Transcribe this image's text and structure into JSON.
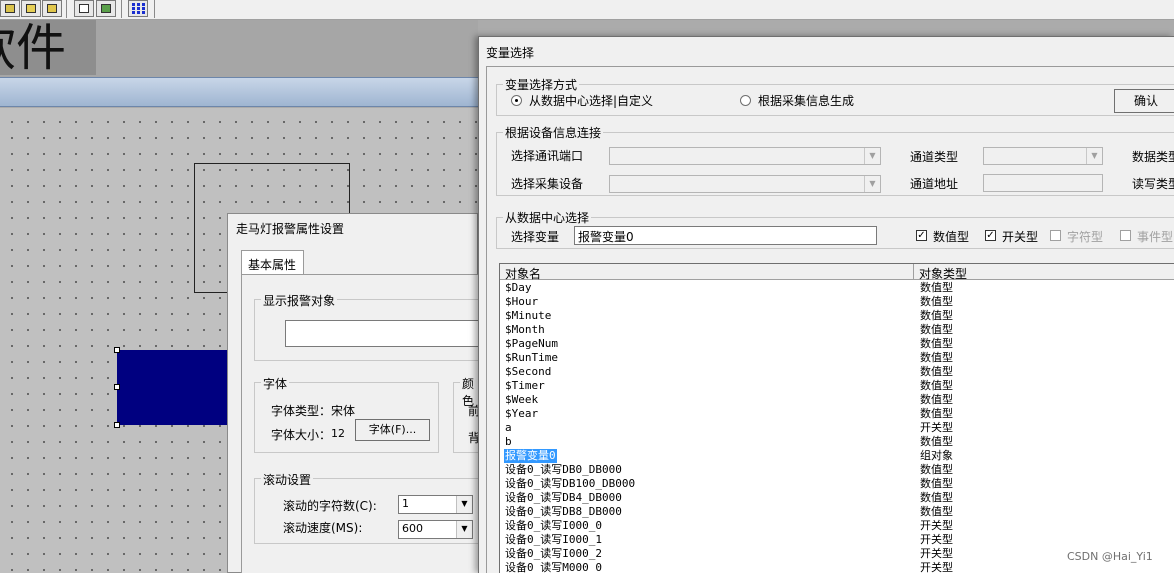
{
  "background": {
    "title_fragment": "软件"
  },
  "marquee_dialog": {
    "title": "走马灯报警属性设置",
    "tab_label": "基本属性",
    "display_group_label": "显示报警对象",
    "display_value": "",
    "font_group_label": "字体",
    "font_type_label": "字体类型：",
    "font_type_value": "宋体",
    "font_size_label": "字体大小：",
    "font_size_value": "12",
    "font_button_label": "字体(F)...",
    "color_group_label": "颜色",
    "color_fore_label": "前",
    "color_back_label": "背",
    "scroll_group_label": "滚动设置",
    "scroll_chars_label": "滚动的字符数(C):",
    "scroll_chars_value": "1",
    "scroll_speed_label": "滚动速度(MS):",
    "scroll_speed_value": "600"
  },
  "var_dialog": {
    "title": "变量选择",
    "mode_group_label": "变量选择方式",
    "mode_option_1": "从数据中心选择|自定义",
    "mode_option_2": "根据采集信息生成",
    "mode_selected": "从数据中心选择|自定义",
    "confirm_button": "确认",
    "device_group_label": "根据设备信息连接",
    "port_label": "选择通讯端口",
    "device_label": "选择采集设备",
    "channel_type_label": "通道类型",
    "channel_addr_label": "通道地址",
    "data_type_label_partial": "数据类型",
    "rw_type_label_partial": "读写类型",
    "datacenter_group_label": "从数据中心选择",
    "select_var_label": "选择变量",
    "select_var_value": "报警变量0",
    "filters": [
      {
        "label": "数值型",
        "checked": true,
        "enabled": true
      },
      {
        "label": "开关型",
        "checked": true,
        "enabled": true
      },
      {
        "label": "字符型",
        "checked": false,
        "enabled": false
      },
      {
        "label": "事件型",
        "checked": false,
        "enabled": false
      }
    ],
    "columns": [
      "对象名",
      "对象类型"
    ],
    "rows": [
      {
        "name": "$Day",
        "type": "数值型"
      },
      {
        "name": "$Hour",
        "type": "数值型"
      },
      {
        "name": "$Minute",
        "type": "数值型"
      },
      {
        "name": "$Month",
        "type": "数值型"
      },
      {
        "name": "$PageNum",
        "type": "数值型"
      },
      {
        "name": "$RunTime",
        "type": "数值型"
      },
      {
        "name": "$Second",
        "type": "数值型"
      },
      {
        "name": "$Timer",
        "type": "数值型"
      },
      {
        "name": "$Week",
        "type": "数值型"
      },
      {
        "name": "$Year",
        "type": "数值型"
      },
      {
        "name": "a",
        "type": "开关型"
      },
      {
        "name": "b",
        "type": "数值型"
      },
      {
        "name": "报警变量0",
        "type": "组对象",
        "selected": true
      },
      {
        "name": "设备0_读写DB0_DB000",
        "type": "数值型"
      },
      {
        "name": "设备0_读写DB100_DB000",
        "type": "数值型"
      },
      {
        "name": "设备0_读写DB4_DB000",
        "type": "数值型"
      },
      {
        "name": "设备0_读写DB8_DB000",
        "type": "数值型"
      },
      {
        "name": "设备0_读写I000_0",
        "type": "开关型"
      },
      {
        "name": "设备0_读写I000_1",
        "type": "开关型"
      },
      {
        "name": "设备0_读写I000_2",
        "type": "开关型"
      },
      {
        "name": "设备0_读写M000_0",
        "type": "开关型"
      }
    ]
  },
  "watermark": "CSDN @Hai_Yi1",
  "colors": {
    "selection": "#3399ff",
    "object_fill": "#000080"
  }
}
